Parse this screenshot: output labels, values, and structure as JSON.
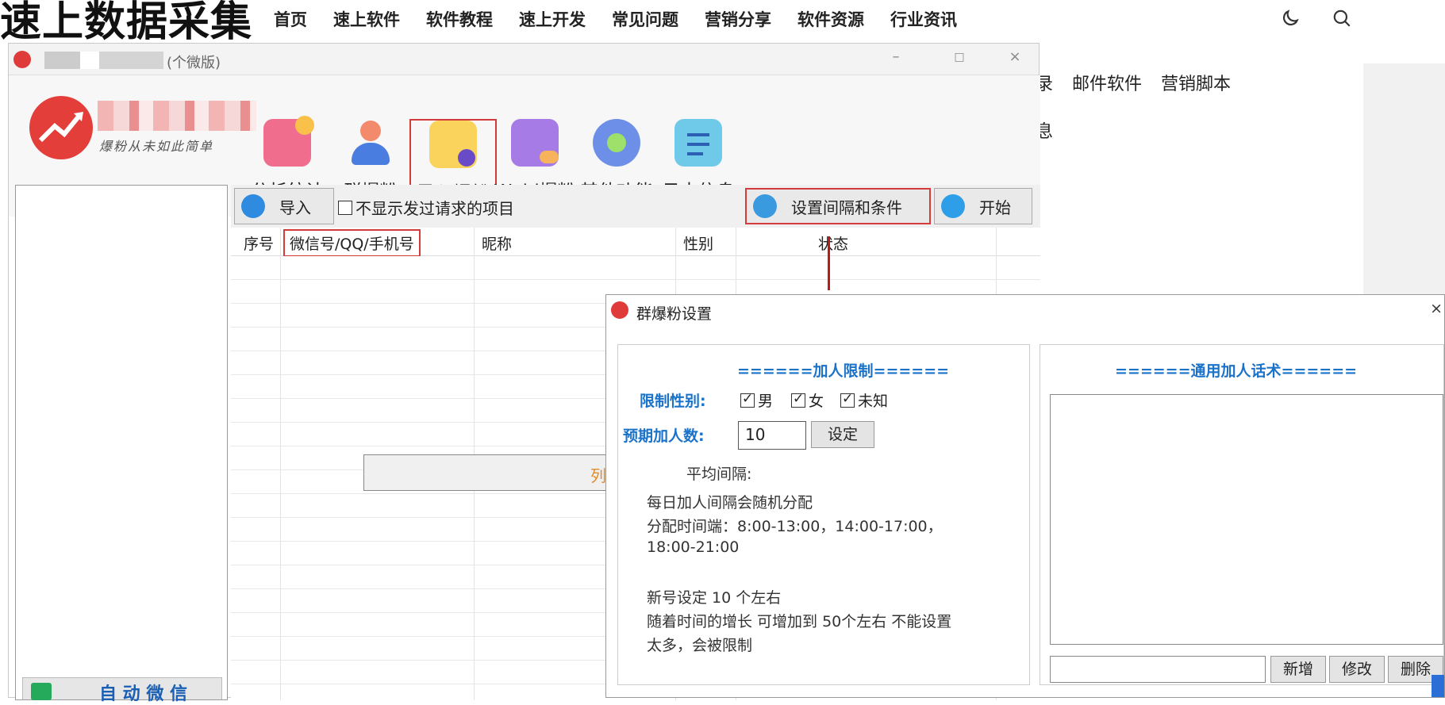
{
  "site": {
    "title": "速上数据采集",
    "nav": [
      "首页",
      "速上软件",
      "软件教程",
      "速上开发",
      "常见问题",
      "营销分享",
      "软件资源",
      "行业资讯"
    ],
    "subnav": [
      "录",
      "邮件软件",
      "营销脚本"
    ],
    "subnav2": "息"
  },
  "app": {
    "window_title": "(个微版)",
    "min_label": "–",
    "max_label": "□",
    "close_label": "×",
    "brand_slogan": "爆粉从未如此简单",
    "tools": [
      {
        "label": "分析统计",
        "icon": "analytics-icon",
        "active": false
      },
      {
        "label": "群爆粉",
        "icon": "user-group-icon",
        "active": false
      },
      {
        "label": "导入爆粉",
        "icon": "import-doc-icon",
        "active": true
      },
      {
        "label": "Wxid爆粉",
        "icon": "wxid-doc-icon",
        "active": false
      },
      {
        "label": "其他功能",
        "icon": "gear-icon",
        "active": false
      },
      {
        "label": "日志信息",
        "icon": "clipboard-icon",
        "active": false
      }
    ],
    "import_btn": "导入",
    "hide_requested_label": "不显示发过请求的项目",
    "settings_btn": "设置间隔和条件",
    "start_btn": "开始",
    "columns": [
      "序号",
      "微信号/QQ/手机号",
      "昵称",
      "性别",
      "状态"
    ],
    "gray_box_text": "列",
    "left_bottom_text": "自 动 微 信"
  },
  "dialog": {
    "title": "群爆粉设置",
    "close": "×",
    "left_head": "======加人限制======",
    "gender_label": "限制性别:",
    "genders": [
      {
        "label": "男",
        "checked": true
      },
      {
        "label": "女",
        "checked": true
      },
      {
        "label": "未知",
        "checked": true
      }
    ],
    "expected_label": "预期加人数:",
    "expected_value": "10",
    "set_btn": "设定",
    "avg_interval": "平均间隔:",
    "lines": [
      "每日加人间隔会随机分配",
      "分配时间端：8:00-13:00，14:00-17:00，",
      "18:00-21:00",
      "新号设定 10 个左右",
      "随着时间的增长 可增加到 50个左右 不能设置",
      "太多，会被限制"
    ],
    "right_head": "======通用加人话术======",
    "add_btn": "新增",
    "edit_btn": "修改",
    "delete_btn": "删除"
  },
  "colors": {
    "accent_red": "#d43b3b",
    "heading_blue": "#1a72c9",
    "logo_red": "#e43e3a"
  }
}
